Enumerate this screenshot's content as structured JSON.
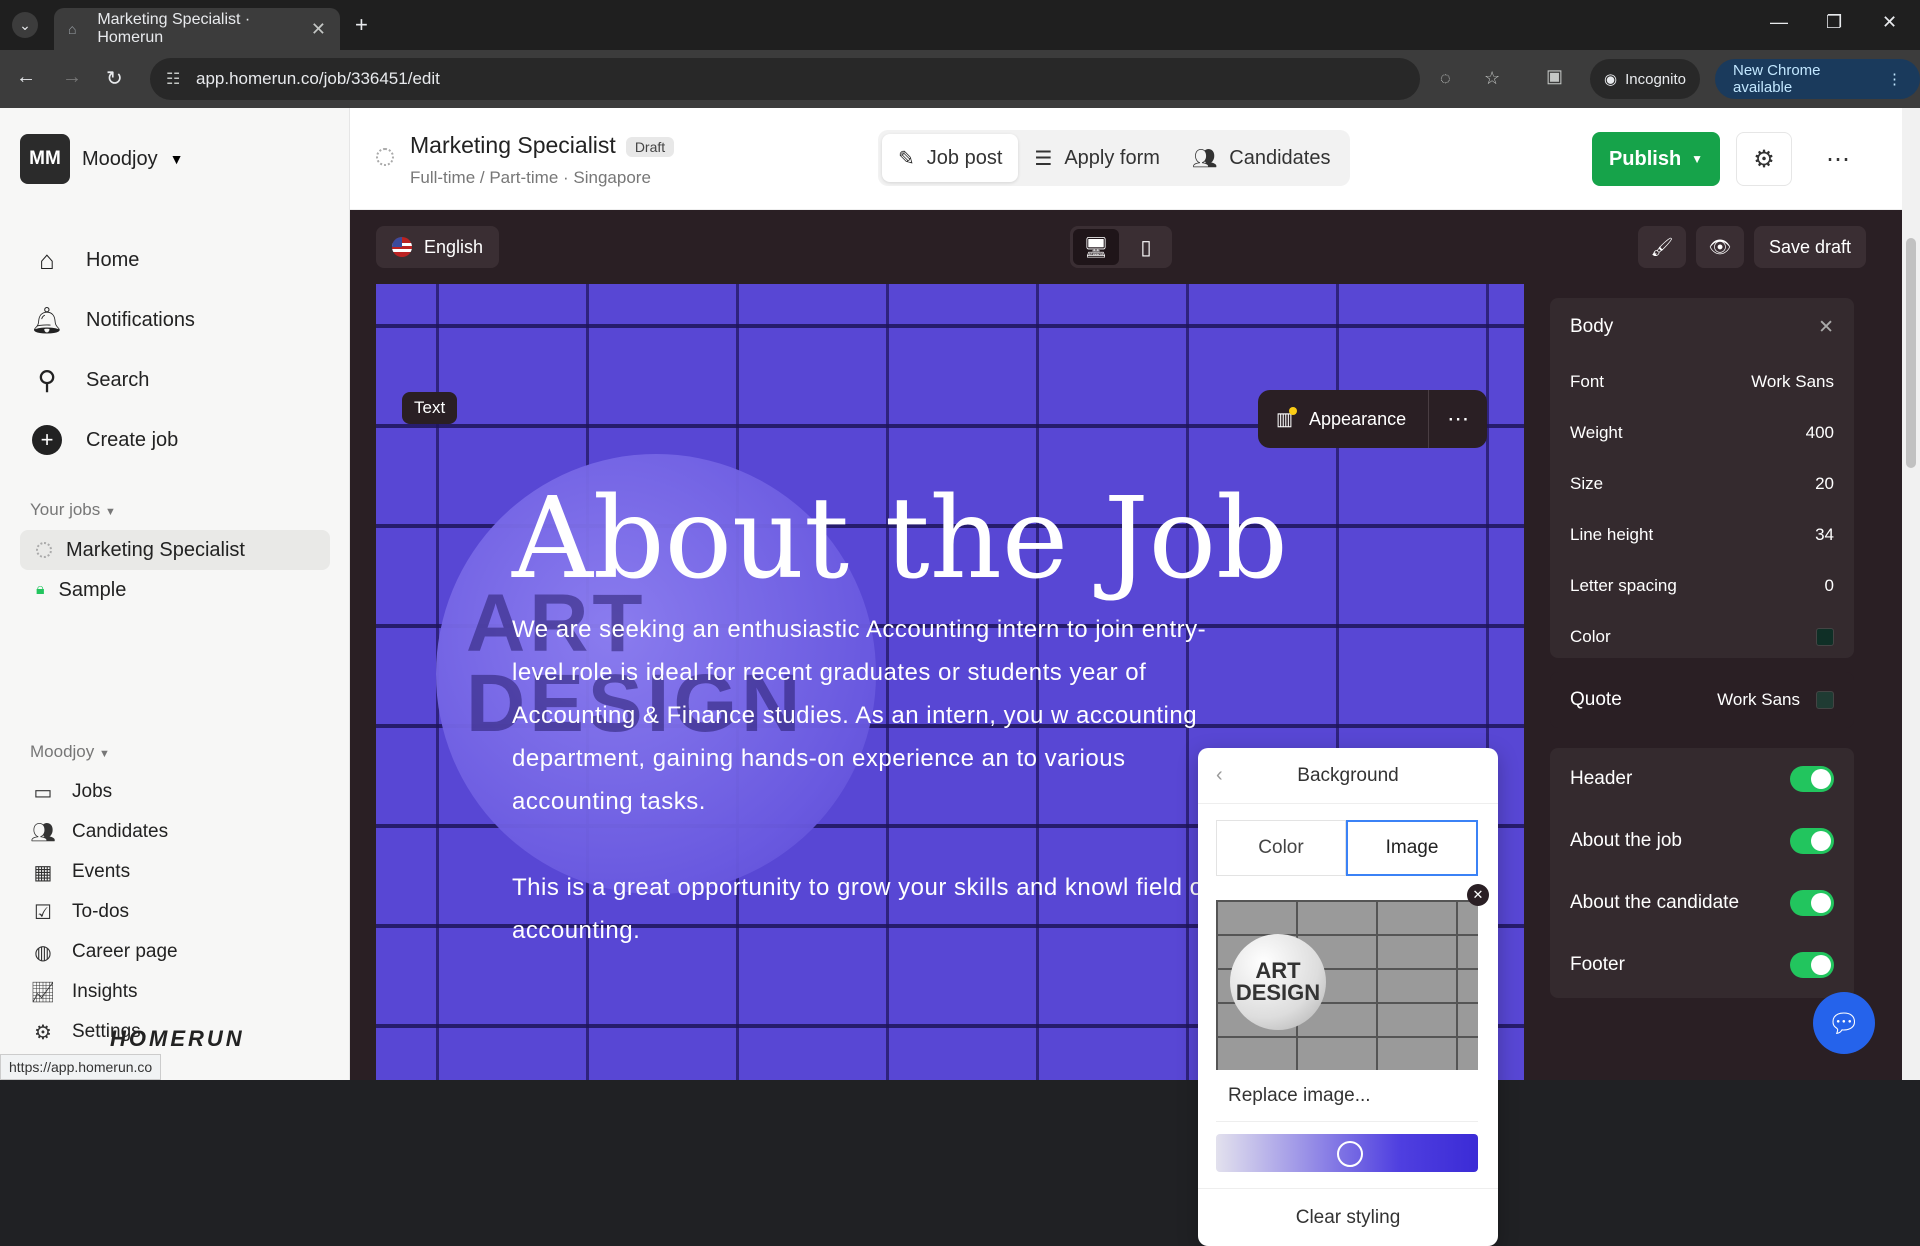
{
  "browser": {
    "tab_title": "Marketing Specialist · Homerun",
    "url": "app.homerun.co/job/336451/edit",
    "incognito_label": "Incognito",
    "update_label": "New Chrome available",
    "status_url": "https://app.homerun.co"
  },
  "sidebar": {
    "workspace_initials": "MM",
    "workspace_name": "Moodjoy",
    "main_nav": [
      {
        "label": "Home"
      },
      {
        "label": "Notifications"
      },
      {
        "label": "Search"
      },
      {
        "label": "Create job"
      }
    ],
    "your_jobs_label": "Your jobs",
    "jobs": [
      {
        "label": "Marketing Specialist"
      },
      {
        "label": "Sample"
      }
    ],
    "org_label": "Moodjoy",
    "org_nav": [
      {
        "label": "Jobs"
      },
      {
        "label": "Candidates"
      },
      {
        "label": "Events"
      },
      {
        "label": "To-dos"
      },
      {
        "label": "Career page"
      },
      {
        "label": "Insights"
      },
      {
        "label": "Settings"
      }
    ],
    "logo_text": "HOMERUN"
  },
  "header": {
    "job_title": "Marketing Specialist",
    "status_badge": "Draft",
    "subtitle": "Full-time / Part-time · Singapore",
    "tabs": [
      {
        "label": "Job post"
      },
      {
        "label": "Apply form"
      },
      {
        "label": "Candidates"
      }
    ],
    "publish_label": "Publish"
  },
  "editor": {
    "language": "English",
    "save_draft_label": "Save draft",
    "block_tag": "Text",
    "heading": "About the Job",
    "paragraph1": "We are seeking an enthusiastic Accounting intern to join entry-level role is ideal for recent graduates or students year of Accounting & Finance studies. As an intern, you w accounting department, gaining hands-on experience an to various accounting tasks.",
    "paragraph2": "This is a great opportunity to grow your skills and knowl field of accounting.",
    "watermark": "ART DESIGN",
    "appearance_label": "Appearance"
  },
  "background_panel": {
    "title": "Background",
    "tab_color": "Color",
    "tab_image": "Image",
    "image_logo_text": "ART DESIGN",
    "replace_label": "Replace image...",
    "overlay_opacity": 0.51,
    "clear_label": "Clear styling"
  },
  "style_panel": {
    "section": "Body",
    "rows": [
      {
        "label": "Font",
        "value": "Work Sans"
      },
      {
        "label": "Weight",
        "value": "400"
      },
      {
        "label": "Size",
        "value": "20"
      },
      {
        "label": "Line height",
        "value": "34"
      },
      {
        "label": "Letter spacing",
        "value": "0"
      },
      {
        "label": "Color",
        "value": ""
      }
    ],
    "color_value": "#0f2f26",
    "quote_label": "Quote",
    "quote_font": "Work Sans",
    "sections": [
      {
        "label": "Header",
        "enabled": true
      },
      {
        "label": "About the job",
        "enabled": true
      },
      {
        "label": "About the candidate",
        "enabled": true
      },
      {
        "label": "Footer",
        "enabled": true
      }
    ]
  },
  "colors": {
    "publish_green": "#16a34a",
    "toggle_green": "#22c55e",
    "selected_tab_blue": "#3b82f6",
    "hero_purple": "#5847d4"
  }
}
